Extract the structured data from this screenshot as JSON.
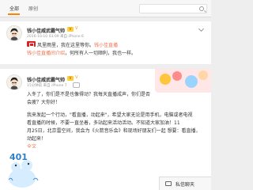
{
  "tabs": {
    "all": "全部",
    "original": "原创"
  },
  "post1": {
    "username": "钱小佳威武霸气帅",
    "badge": "V",
    "vip": "V",
    "meta": "2016-10-10 03:09 来自 iPhone 6",
    "line1": "风里雨里，我在这里等你。",
    "line1_prefix": "钱小佳直播",
    "line1_mention": "钱小佳直播间介绍",
    "line1_rest": "，何所有人一切顺利，我也一样。"
  },
  "post2": {
    "username": "钱小佳威武霸气帅",
    "badge": "V",
    "vip": "V",
    "meta": "15分钟前 来自 iPhone 7",
    "lines": [
      "入冬了，你们是不是也像得动？我每天直播成声，你们是否",
      "会疲？大你好！",
      "",
      "我来发起一个行动，\"看直播，动起来\"，希望大家无论是用手机，电脑或者电视",
      "看直播的时候，不要一直坐着，多站起来活动活动。不知道大家加油！11",
      "月25日，北京雷空间，我会为《火箭音乐会》和现场好朋友们一起 想要：看直播，",
      "动起来！"
    ],
    "translate_label": "全文",
    "image_number": "401"
  },
  "messages": {
    "label": "私信聊天"
  },
  "colors": {
    "accent": "#ff8200",
    "link": "#eb7350",
    "red": "#e02020"
  }
}
